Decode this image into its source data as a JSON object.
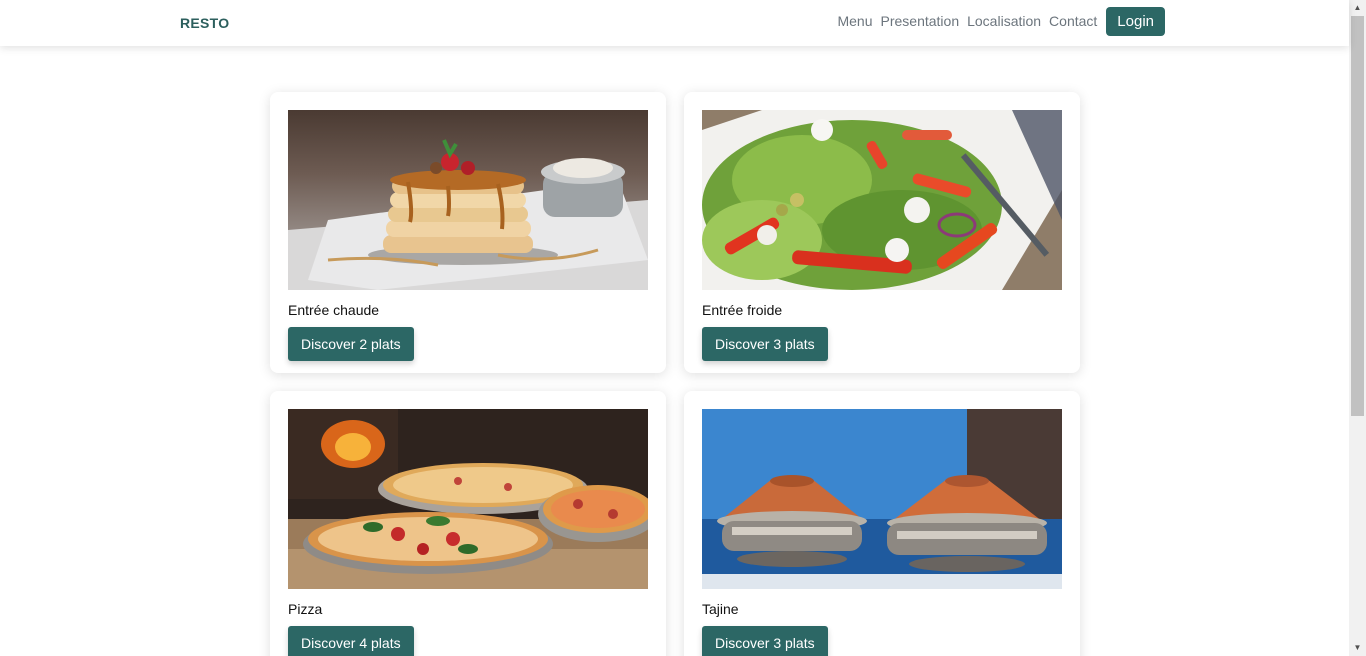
{
  "navbar": {
    "brand": "RESTO",
    "links": [
      "Menu",
      "Presentation",
      "Localisation",
      "Contact"
    ],
    "login_label": "Login"
  },
  "cards": [
    {
      "title": "Entrée chaude",
      "button": "Discover 2 plats",
      "image": "pancakes-photo"
    },
    {
      "title": "Entrée froide",
      "button": "Discover 3 plats",
      "image": "salad-photo"
    },
    {
      "title": "Pizza",
      "button": "Discover 4 plats",
      "image": "pizza-photo"
    },
    {
      "title": "Tajine",
      "button": "Discover 3 plats",
      "image": "tajine-photo"
    }
  ],
  "colors": {
    "accent": "#2c6765",
    "brand": "#2c5f5d"
  }
}
